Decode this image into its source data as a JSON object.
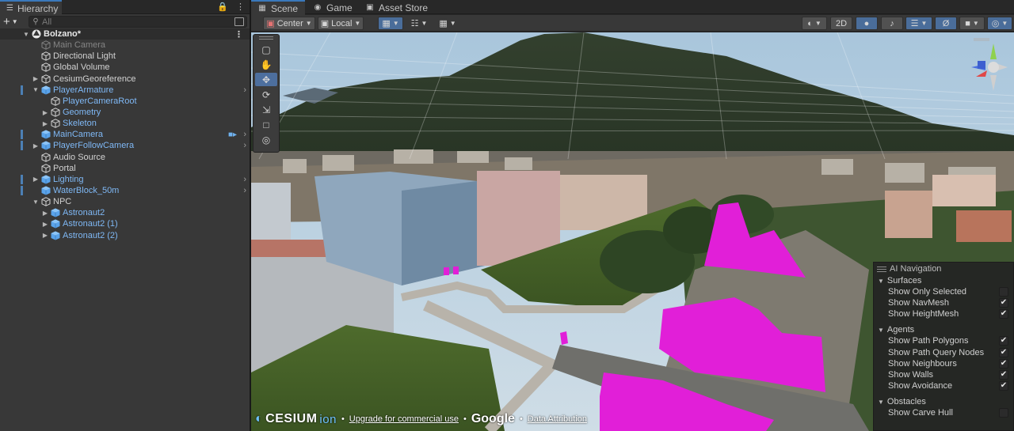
{
  "hierarchy": {
    "tab_label": "Hierarchy",
    "add_label": "+",
    "search_placeholder": "All",
    "items": [
      {
        "label": "Bolzano*",
        "depth": 0,
        "kind": "scene",
        "expanded": true,
        "icon": "unity-scene-icon",
        "kebab": true
      },
      {
        "label": "Main Camera",
        "depth": 1,
        "kind": "disabled",
        "icon": "cube-icon"
      },
      {
        "label": "Directional Light",
        "depth": 1,
        "kind": "normal",
        "icon": "cube-icon"
      },
      {
        "label": "Global Volume",
        "depth": 1,
        "kind": "normal",
        "icon": "cube-icon"
      },
      {
        "label": "CesiumGeoreference",
        "depth": 1,
        "kind": "normal",
        "icon": "cube-icon",
        "arrow": "collapsed"
      },
      {
        "label": "PlayerArmature",
        "depth": 1,
        "kind": "prefab",
        "icon": "prefab-icon",
        "arrow": "expanded",
        "bar": true,
        "chev": true
      },
      {
        "label": "PlayerCameraRoot",
        "depth": 2,
        "kind": "prefab",
        "icon": "cube-icon"
      },
      {
        "label": "Geometry",
        "depth": 2,
        "kind": "prefab",
        "icon": "cube-icon",
        "arrow": "collapsed"
      },
      {
        "label": "Skeleton",
        "depth": 2,
        "kind": "prefab",
        "icon": "cube-icon",
        "arrow": "collapsed"
      },
      {
        "label": "MainCamera",
        "depth": 1,
        "kind": "prefab",
        "icon": "prefab-icon",
        "bar": true,
        "chev": true,
        "camera": true
      },
      {
        "label": "PlayerFollowCamera",
        "depth": 1,
        "kind": "prefab",
        "icon": "prefab-icon",
        "arrow": "collapsed",
        "bar": true,
        "chev": true
      },
      {
        "label": "Audio Source",
        "depth": 1,
        "kind": "normal",
        "icon": "cube-icon"
      },
      {
        "label": "Portal",
        "depth": 1,
        "kind": "normal",
        "icon": "cube-icon"
      },
      {
        "label": "Lighting",
        "depth": 1,
        "kind": "prefab",
        "icon": "prefab-icon",
        "arrow": "collapsed",
        "bar": true,
        "chev": true
      },
      {
        "label": "WaterBlock_50m",
        "depth": 1,
        "kind": "prefab",
        "icon": "prefab-icon",
        "bar": true,
        "chev": true
      },
      {
        "label": "NPC",
        "depth": 1,
        "kind": "normal",
        "icon": "cube-icon",
        "arrow": "expanded"
      },
      {
        "label": "Astronaut2",
        "depth": 2,
        "kind": "prefab",
        "icon": "prefab-icon",
        "arrow": "collapsed"
      },
      {
        "label": "Astronaut2 (1)",
        "depth": 2,
        "kind": "prefab",
        "icon": "prefab-icon",
        "arrow": "collapsed"
      },
      {
        "label": "Astronaut2 (2)",
        "depth": 2,
        "kind": "prefab",
        "icon": "prefab-icon",
        "arrow": "collapsed"
      }
    ]
  },
  "scene_tabs": {
    "scene": "Scene",
    "game": "Game",
    "asset_store": "Asset Store"
  },
  "toolbar": {
    "pivot_label": "Center",
    "space_label": "Local",
    "mode_2d": "2D"
  },
  "ai_navigation": {
    "title": "AI Navigation",
    "sections": [
      {
        "name": "Surfaces",
        "options": [
          {
            "label": "Show Only Selected",
            "checked": false
          },
          {
            "label": "Show NavMesh",
            "checked": true
          },
          {
            "label": "Show HeightMesh",
            "checked": true
          }
        ]
      },
      {
        "name": "Agents",
        "options": [
          {
            "label": "Show Path Polygons",
            "checked": true
          },
          {
            "label": "Show Path Query Nodes",
            "checked": true
          },
          {
            "label": "Show Neighbours",
            "checked": true
          },
          {
            "label": "Show Walls",
            "checked": true
          },
          {
            "label": "Show Avoidance",
            "checked": true
          }
        ]
      },
      {
        "name": "Obstacles",
        "options": [
          {
            "label": "Show Carve Hull",
            "checked": false
          }
        ]
      }
    ]
  },
  "attribution": {
    "cesium": "CESIUM",
    "ion": "ion",
    "upgrade": "Upgrade for commercial use",
    "google": "Google",
    "data_attribution": "Data Attribution"
  },
  "colors": {
    "accent_blue": "#3a79bb",
    "prefab_text": "#7fb8f5",
    "navmesh_magenta": "#e11fd8"
  }
}
